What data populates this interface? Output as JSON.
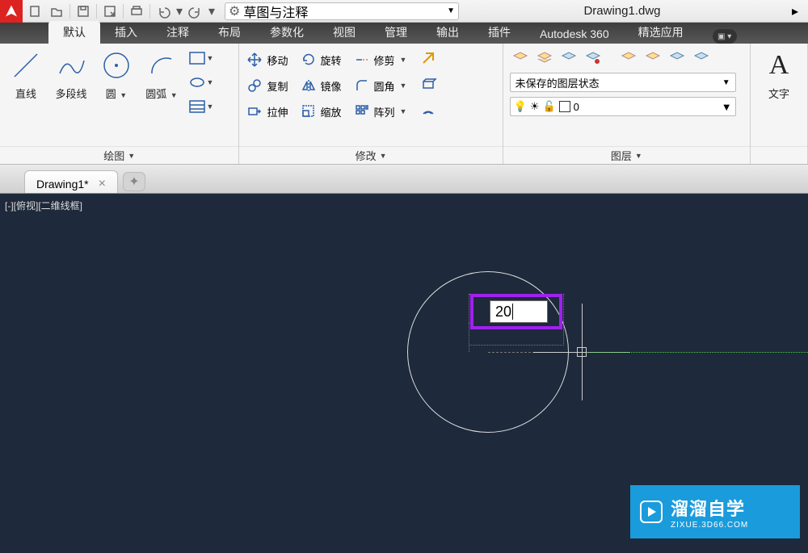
{
  "title": "Drawing1.dwg",
  "workspace": "草图与注释",
  "tabs": {
    "t0": "默认",
    "t1": "插入",
    "t2": "注释",
    "t3": "布局",
    "t4": "参数化",
    "t5": "视图",
    "t6": "管理",
    "t7": "输出",
    "t8": "插件",
    "t9": "Autodesk 360",
    "t10": "精选应用"
  },
  "draw_panel": {
    "title": "绘图",
    "line": "直线",
    "pline": "多段线",
    "circle": "圆",
    "arc": "圆弧"
  },
  "modify_panel": {
    "title": "修改",
    "move": "移动",
    "rotate": "旋转",
    "trim": "修剪",
    "copy": "复制",
    "mirror": "镜像",
    "fillet": "圆角",
    "stretch": "拉伸",
    "scale": "缩放",
    "array": "阵列"
  },
  "layer_panel": {
    "title": "图层",
    "state": "未保存的图层状态",
    "current": "0"
  },
  "annot_panel": {
    "text_label": "文字"
  },
  "filetab": "Drawing1*",
  "viewport": "[-][俯视][二维线框]",
  "input_value": "20",
  "watermark": {
    "big": "溜溜自学",
    "small": "ZIXUE.3D66.COM"
  }
}
